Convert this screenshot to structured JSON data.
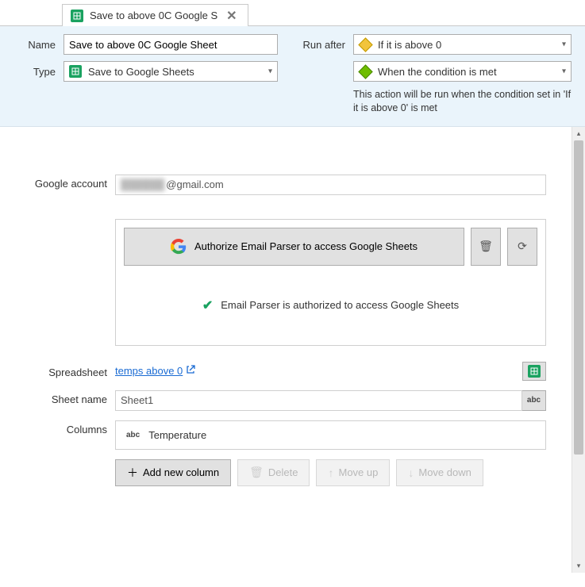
{
  "tab": {
    "title": "Save to above 0C Google S",
    "close_glyph": "✕"
  },
  "form": {
    "name_label": "Name",
    "name_value": "Save to above 0C Google Sheet",
    "type_label": "Type",
    "type_value": "Save to Google Sheets",
    "run_after_label": "Run after",
    "run_after_value": "If it is above 0",
    "condition_value": "When the condition is met",
    "helper_text": "This action will be run when the condition set in 'If it is above 0' is met"
  },
  "google": {
    "account_label": "Google account",
    "account_masked": "██████",
    "account_domain": "@gmail.com",
    "authorize_label": "Authorize Email Parser to access Google Sheets",
    "status_text": "Email Parser is authorized to access Google Sheets"
  },
  "spreadsheet": {
    "label": "Spreadsheet",
    "link_text": "temps above 0"
  },
  "sheet": {
    "label": "Sheet name",
    "value": "Sheet1"
  },
  "columns": {
    "label": "Columns",
    "items": [
      "Temperature"
    ]
  },
  "buttons": {
    "add_column": "Add new column",
    "delete": "Delete",
    "move_up": "Move up",
    "move_down": "Move down"
  },
  "icons": {
    "plus": "＋",
    "trash": "🗑",
    "arrow_up": "↑",
    "arrow_down": "↓",
    "refresh": "⟳",
    "external": "↗",
    "check": "✔",
    "caret": "▾"
  }
}
